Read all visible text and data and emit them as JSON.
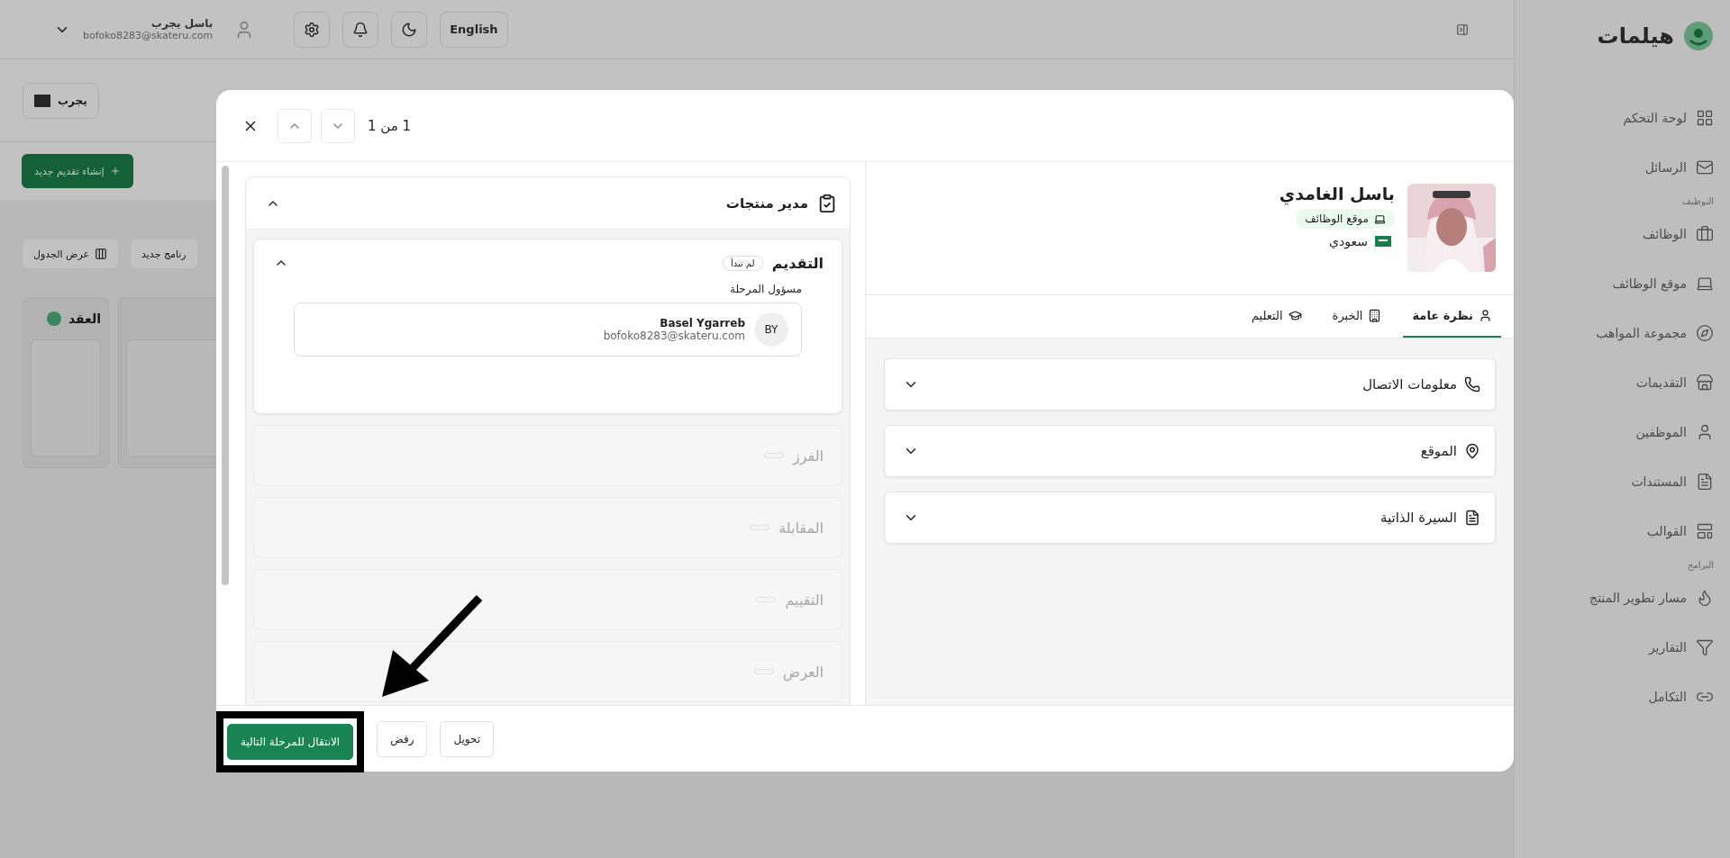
{
  "sidebar": {
    "logo": "هيلمات",
    "items": [
      {
        "kind": "item",
        "label": "لوحة التحكم"
      },
      {
        "kind": "item",
        "label": "الرسائل"
      },
      {
        "kind": "section",
        "label": "التوظيف"
      },
      {
        "kind": "item",
        "label": "الوظائف"
      },
      {
        "kind": "item",
        "label": "موقع الوظائف"
      },
      {
        "kind": "item",
        "label": "مجموعة المواهب"
      },
      {
        "kind": "item",
        "label": "التقديمات"
      },
      {
        "kind": "item",
        "label": "الموظفين"
      },
      {
        "kind": "item",
        "label": "المستندات"
      },
      {
        "kind": "item",
        "label": "القوالب"
      },
      {
        "kind": "section",
        "label": "البرامج"
      },
      {
        "kind": "item",
        "label": "مسار تطوير المنتج"
      },
      {
        "kind": "item",
        "label": "التقارير"
      },
      {
        "kind": "item",
        "label": "التكامل"
      }
    ]
  },
  "top_bar": {
    "language": "English",
    "user": {
      "name": "باسل يجرب",
      "email": "bofoko8283@skateru.com"
    }
  },
  "page": {
    "toolbar_button": "يجرب",
    "create_button": "إنشاء تقديم جديد",
    "view_buttons": [
      "رنامج جديد",
      "عرض الجدول"
    ],
    "column": {
      "title": "العقد"
    }
  },
  "modal": {
    "counter": "1 من 1",
    "job": {
      "title": "مدير منتجات",
      "expanded": true
    },
    "stages": [
      {
        "name": "التقديم",
        "status": "لم تبدأ",
        "expanded": true,
        "disabled": false,
        "owner_label": "مسؤول المرحلة",
        "owner": {
          "initials": "BY",
          "name": "Basel Ygarreb",
          "email": "bofoko8283@skateru.com"
        }
      },
      {
        "name": "الفرز",
        "expanded": false,
        "disabled": true
      },
      {
        "name": "المقابلة",
        "expanded": false,
        "disabled": true
      },
      {
        "name": "التقييم",
        "expanded": false,
        "disabled": true
      },
      {
        "name": "العرض",
        "expanded": false,
        "disabled": true
      }
    ],
    "candidate": {
      "name": "باسل الغامدي",
      "source": "موقع الوظائف",
      "nationality": "سعودي"
    },
    "tabs": [
      {
        "label": "نظرة عامة",
        "selected": true
      },
      {
        "label": "الخبرة",
        "selected": false
      },
      {
        "label": "التعليم",
        "selected": false
      }
    ],
    "sections": [
      {
        "title": "معلومات الاتصال",
        "expanded": false
      },
      {
        "title": "الموقع",
        "expanded": false
      },
      {
        "title": "السيرة الذاتية",
        "expanded": false
      }
    ],
    "actions": [
      {
        "label": "تحويل",
        "kind": "secondary",
        "highlighted": false
      },
      {
        "label": "رفض",
        "kind": "secondary",
        "highlighted": false
      },
      {
        "label": "الانتقال للمرحلة التالية",
        "kind": "primary",
        "highlighted": true
      }
    ]
  }
}
